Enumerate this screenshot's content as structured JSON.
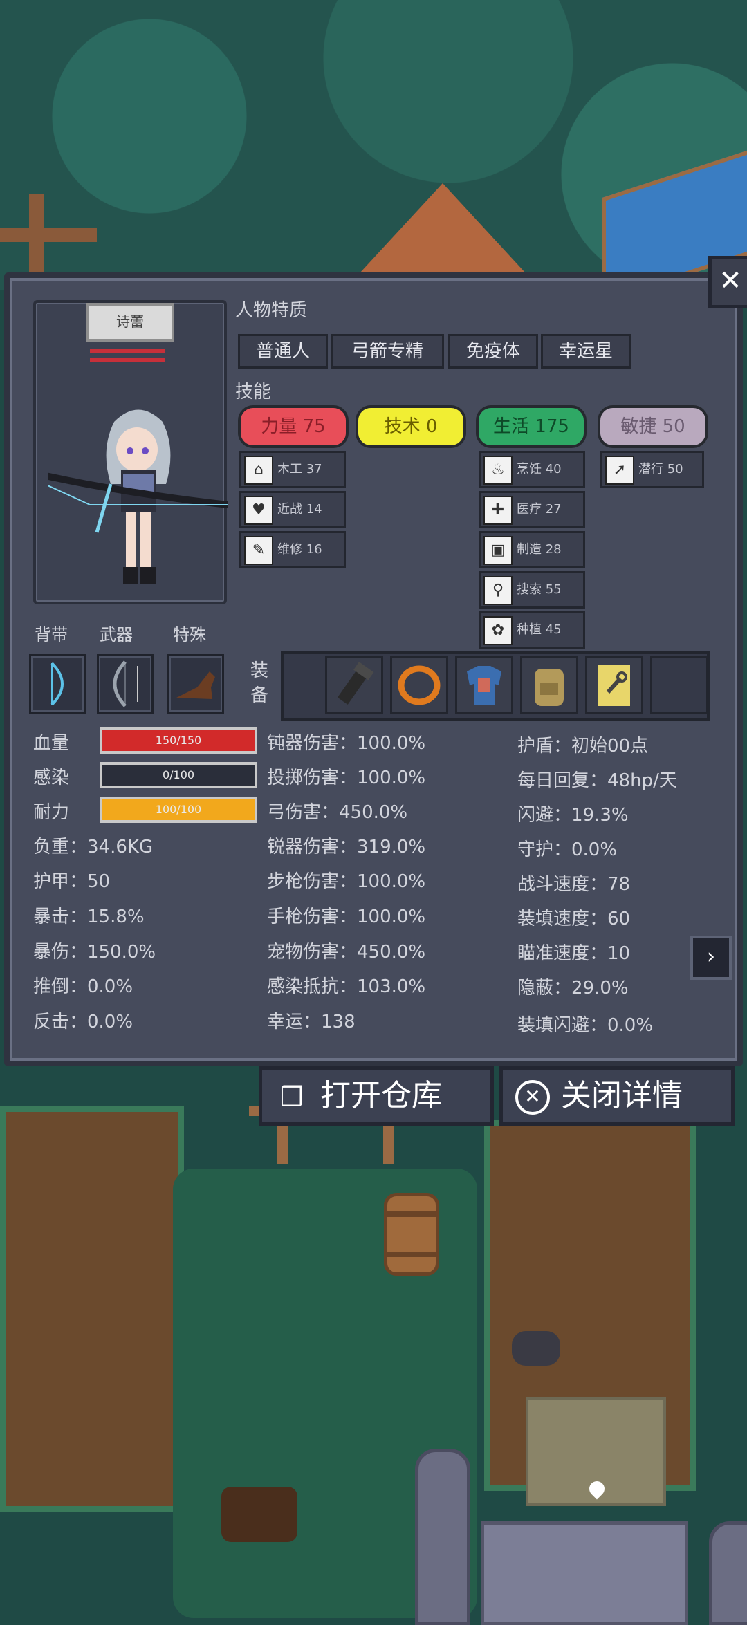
{
  "character": {
    "name": "诗蕾"
  },
  "headers": {
    "traits": "人物特质",
    "skills": "技能",
    "equip_vertical": "装备",
    "bag": "背带",
    "weapon": "武器",
    "special": "特殊"
  },
  "traits": [
    "普通人",
    "弓箭专精",
    "免疫体",
    "幸运星"
  ],
  "skills": [
    {
      "label": "力量 75",
      "color": "#e84e59"
    },
    {
      "label": "技术 0",
      "color": "#f1ee33"
    },
    {
      "label": "生活 175",
      "color": "#2fa865"
    },
    {
      "label": "敏捷 50",
      "color": "#b9a9be"
    }
  ],
  "subskills": {
    "col1": [
      {
        "icon": "house-icon",
        "label": "木工 37"
      },
      {
        "icon": "heart-icon",
        "label": "近战 14"
      },
      {
        "icon": "wrench-icon",
        "label": "维修 16"
      }
    ],
    "col3": [
      {
        "icon": "pot-icon",
        "label": "烹饪 40"
      },
      {
        "icon": "medkit-icon",
        "label": "医疗 27"
      },
      {
        "icon": "craft-icon",
        "label": "制造 28"
      },
      {
        "icon": "search-icon",
        "label": "搜索 55"
      },
      {
        "icon": "plant-icon",
        "label": "种植 45"
      }
    ],
    "col4": [
      {
        "icon": "run-icon",
        "label": "潜行 50"
      }
    ]
  },
  "bars": [
    {
      "label": "血量",
      "value": "150/150",
      "fill": 1.0,
      "color": "#d22a2a"
    },
    {
      "label": "感染",
      "value": "0/100",
      "fill": 0.0,
      "color": "#6a7084"
    },
    {
      "label": "耐力",
      "value": "100/100",
      "fill": 1.0,
      "color": "#f2a81c"
    }
  ],
  "stats_left": [
    "负重：34.6KG",
    "护甲：50",
    "暴击：15.8%",
    "暴伤：150.0%",
    "推倒：0.0%",
    "反击：0.0%"
  ],
  "stats_mid": [
    "钝器伤害：100.0%",
    "投掷伤害：100.0%",
    "弓伤害：450.0%",
    "锐器伤害：319.0%",
    "步枪伤害：100.0%",
    "手枪伤害：100.0%",
    "宠物伤害：450.0%",
    "感染抵抗：103.0%",
    "幸运：138"
  ],
  "stats_right": [
    "护盾：初始00点",
    "每日回复：48hp/天",
    "闪避：19.3%",
    "守护：0.0%",
    "战斗速度：78",
    "装填速度：60",
    "瞄准速度：10",
    "隐蔽：29.0%",
    "装填闪避：0.0%"
  ],
  "buttons": {
    "open": "打开仓库",
    "close": "关闭详情"
  },
  "colors": {
    "panel": "#464b5c",
    "text": "#d2d4dc"
  }
}
